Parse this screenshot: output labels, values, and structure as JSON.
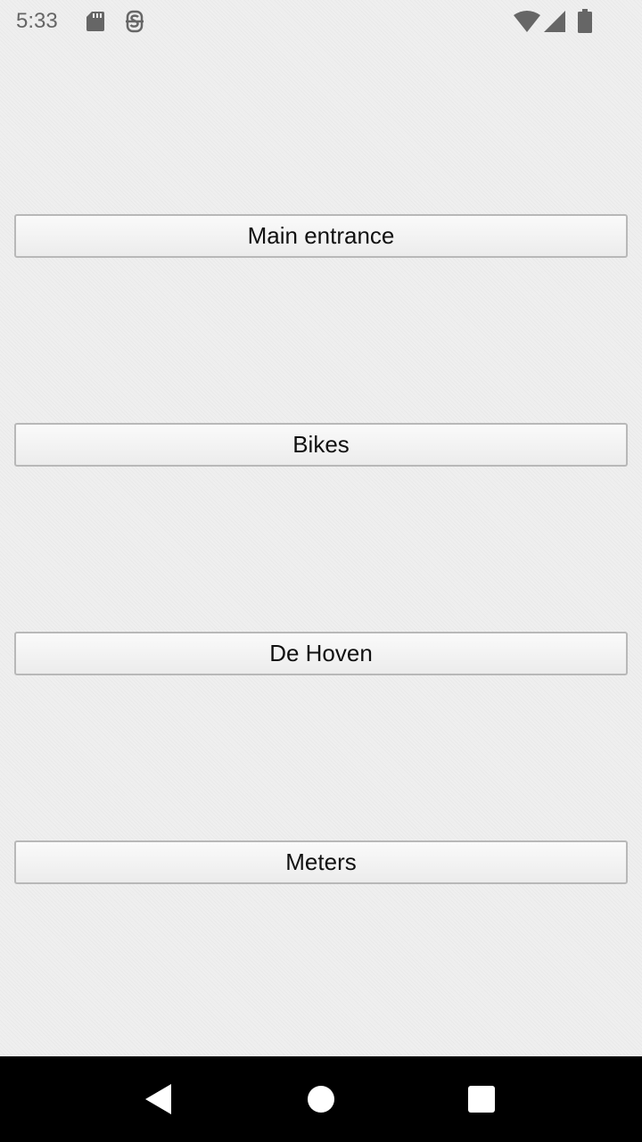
{
  "status_bar": {
    "time": "5:33",
    "icons": [
      "sd-card-icon",
      "sync-app-icon",
      "wifi-icon",
      "cellular-signal-icon",
      "battery-icon"
    ]
  },
  "buttons": [
    {
      "label": "Main entrance"
    },
    {
      "label": "Bikes"
    },
    {
      "label": "De Hoven"
    },
    {
      "label": "Meters"
    }
  ],
  "nav_bar": {
    "icons": [
      "back-icon",
      "home-icon",
      "recents-icon"
    ]
  },
  "colors": {
    "background": "#efefef",
    "button_border": "#b8b8b8",
    "nav_background": "#000000",
    "status_icon": "#666666"
  }
}
